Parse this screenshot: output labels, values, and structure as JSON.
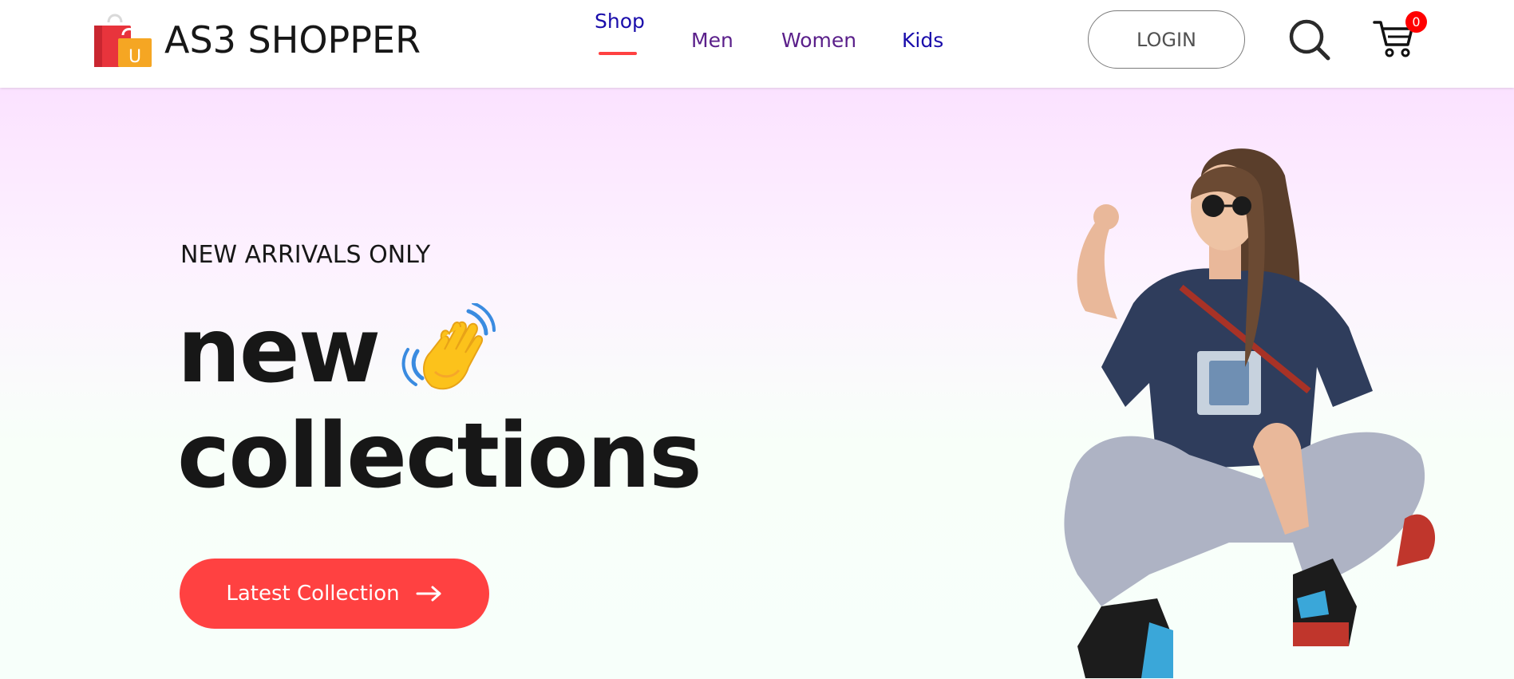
{
  "brand": {
    "name": "AS3 SHOPPER",
    "logo_icon": "shopping-bags-icon"
  },
  "nav": {
    "items": [
      {
        "label": "Shop",
        "active": true
      },
      {
        "label": "Men",
        "active": false
      },
      {
        "label": "Women",
        "active": false
      },
      {
        "label": "Kids",
        "active": false
      }
    ]
  },
  "header": {
    "login_label": "LOGIN",
    "search_icon": "search-icon",
    "cart_icon": "cart-icon",
    "cart_count": "0"
  },
  "hero": {
    "kicker": "NEW ARRIVALS ONLY",
    "title_line1": "new",
    "title_line2": "collections",
    "hand_icon": "waving-hand-icon",
    "cta_label": "Latest Collection",
    "cta_icon": "arrow-right-icon",
    "image": "fashion-model-photo"
  },
  "colors": {
    "accent": "#ff4141",
    "text": "#171717",
    "nav_blue": "#1a0dab",
    "nav_purple": "#5a1f8a",
    "hero_top": "#fbe2ff",
    "hero_bottom": "#f7fffa",
    "badge": "#ff0000"
  }
}
